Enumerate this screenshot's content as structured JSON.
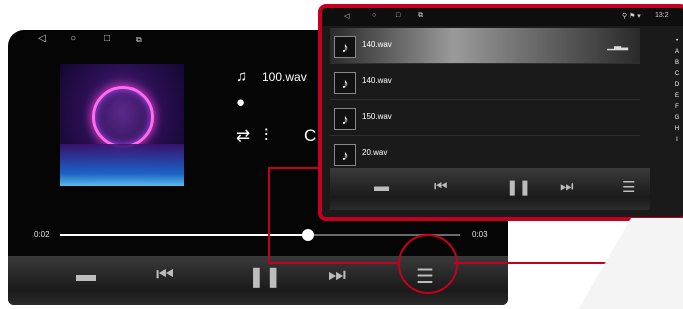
{
  "main_screen": {
    "system_bar": {
      "icons": [
        "back-icon",
        "home-icon",
        "recents-icon",
        "screenshot-icon"
      ]
    },
    "now_playing": {
      "track_name": "100.wav",
      "time_elapsed": "0:02",
      "time_total": "0:03",
      "progress": 0.62
    },
    "dock": {
      "buttons": [
        "folder-icon",
        "previous-icon",
        "pause-icon",
        "next-icon",
        "playlist-icon"
      ]
    }
  },
  "playlist_overlay": {
    "items": [
      {
        "label": "140.wav",
        "active": true
      },
      {
        "label": "140.wav",
        "active": false
      },
      {
        "label": "150.wav",
        "active": false
      },
      {
        "label": "20.wav",
        "active": false
      }
    ],
    "alpha_index": [
      "•",
      "A",
      "B",
      "C",
      "D",
      "E",
      "F",
      "G",
      "H",
      "I"
    ],
    "status_time": "13:2",
    "highlight_color": "#c3001f"
  }
}
